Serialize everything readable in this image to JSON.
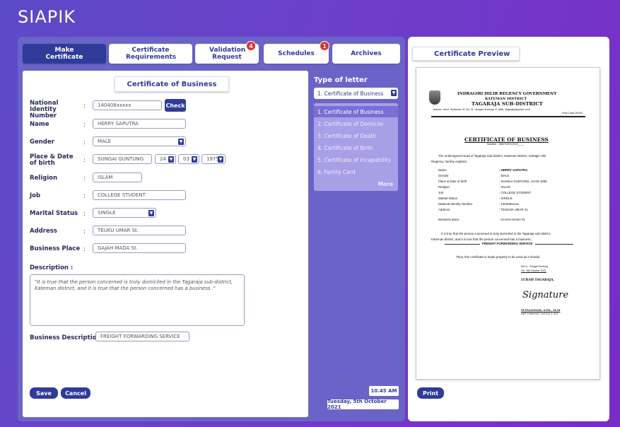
{
  "app": {
    "logo": "SIAPIK"
  },
  "tabs": [
    {
      "label": "Make Certificate",
      "active": true
    },
    {
      "label": "Certificate Requirements"
    },
    {
      "label": "Validation Request",
      "badge": "4"
    },
    {
      "label": "Schedules",
      "badge": "1"
    },
    {
      "label": "Archives"
    }
  ],
  "form": {
    "title": "Certificate of Business",
    "national_id": {
      "label": "National Identity Number",
      "value": "140408xxxxx",
      "button": "Check"
    },
    "name": {
      "label": "Name",
      "value": "HERRY SAPUTRA"
    },
    "gender": {
      "label": "Gender",
      "value": "MALE"
    },
    "birth": {
      "label": "Place & Date of birth",
      "place": "SUNGAI GUNTUNG",
      "day": "24",
      "month": "03",
      "year": "1975"
    },
    "religion": {
      "label": "Religion",
      "value": "ISLAM"
    },
    "job": {
      "label": "Job",
      "value": "COLLEGE STUDENT"
    },
    "marital": {
      "label": "Marital Status",
      "value": "SINGLE"
    },
    "address": {
      "label": "Address",
      "value": "TEUKU UMAR St."
    },
    "business_place": {
      "label": "Business Place",
      "value": "GAJAH MADA St."
    },
    "description_label": "Description :",
    "description": "\"It is true that the person concerned is truly domiciled in the Tagaraja sub-district, Kateman district, and it is true that the person concerned has a business .\"",
    "business_desc": {
      "label": "Business Description :",
      "value": "FREIGHT FORWARDING SERVICE"
    },
    "save": "Save",
    "cancel": "Cancel",
    "colon": ":"
  },
  "letter": {
    "title": "Type of letter",
    "selected": "1. Certificate of Business",
    "options": [
      "1. Certificate of Business",
      "2. Certificate of Domicile",
      "3. Certificate of Death",
      "4. Certificate of Birth",
      "5. Certificate of Incapability",
      "6. Family Card"
    ],
    "more": "More",
    "time": "10.45 AM",
    "date": "Tuesday, 5th October 2021"
  },
  "preview": {
    "title": "Certificate Preview",
    "print": "Print",
    "doc": {
      "gov": "INDRAGIRI HILIR REGENCY GOVERNMENT",
      "district": "KATEMAN DISTRICT",
      "subdistrict": "TAGARAJA SUB-DISTRICT",
      "address": "Adress: Jend. Sudirman St. No. 31, Sungai Guntung, E_Mail: Tagaraja@yahoo.com",
      "postcode": "Post Code 29255",
      "heading": "CERTIFICATE OF BUSINESS",
      "number": "Number : 560/TGR-K/VIII/____",
      "intro": "The undersigned Head of Tagaraja Sub-district, Kateman District, Indragiri Hilir",
      "intro2": "Regency, hereby explains :",
      "fields": [
        {
          "k": "Name",
          "v": ": HERRY SAPUTRA"
        },
        {
          "k": "Gender",
          "v": ": MALE"
        },
        {
          "k": "Place & Date of birth",
          "v": ": SUNGAI GUNTUNG, 24-03-1995"
        },
        {
          "k": "Religion",
          "v": ": ISLAM"
        },
        {
          "k": "Job",
          "v": ": COLLEGE STUDENT"
        },
        {
          "k": "Marital Status",
          "v": ": SINGLE"
        },
        {
          "k": "National Identity Number",
          "v": ": 140408xxxxx"
        },
        {
          "k": "Address",
          "v": ": TEUKUR UMAR St."
        }
      ],
      "bplace": {
        "k": "Business place",
        "v": ": GAJAH MADA St."
      },
      "true1": "It is true that the person concerned is truly domiciled in the Tagaraja sub-district,",
      "true2": "Kateman district, and it is true that the person concerned has a business :",
      "service": "FREIGHT FORWARDING SERVICE",
      "made": "Thus, this certificate is made properly to be used as it should.",
      "setin": "Set in        : Sungai  Guntung",
      "on": "On            : 5th October 2021",
      "lurah": "LURAH TAGARAJA,",
      "signature": "Signature",
      "official": "SUPIANSYAH, S.PD., M.SI",
      "nip": "NIP 19800901 201102 1 001"
    }
  }
}
